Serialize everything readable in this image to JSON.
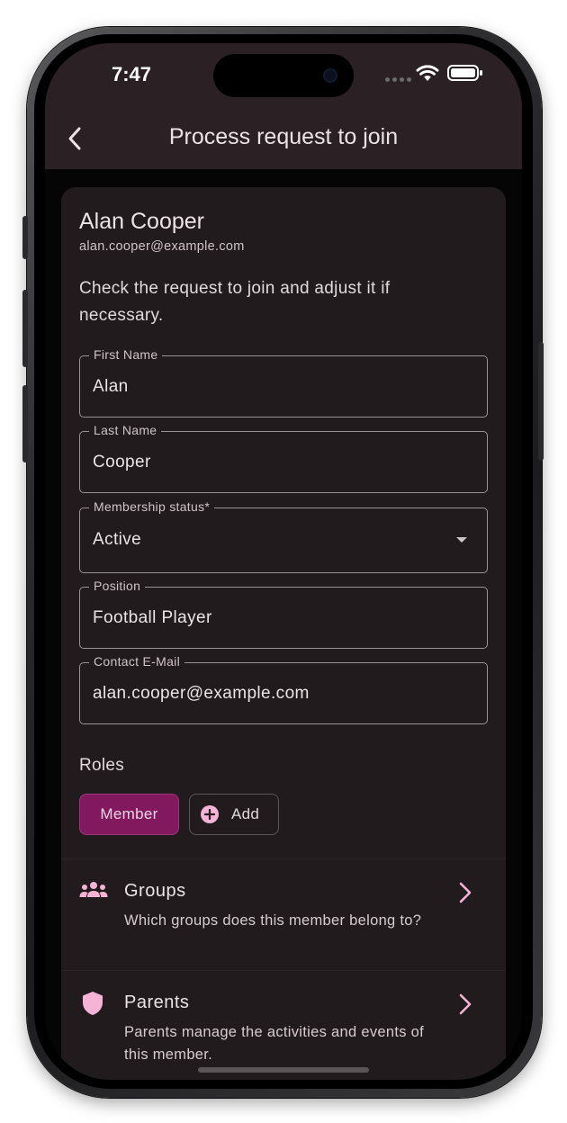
{
  "status_bar": {
    "time": "7:47"
  },
  "app_bar": {
    "title": "Process request to join",
    "back_icon": "chevron-left-icon"
  },
  "member": {
    "name": "Alan Cooper",
    "email": "alan.cooper@example.com"
  },
  "intro": "Check the request to join and adjust it if necessary.",
  "fields": {
    "first_name": {
      "label": "First Name",
      "value": "Alan"
    },
    "last_name": {
      "label": "Last Name",
      "value": "Cooper"
    },
    "membership_status": {
      "label": "Membership status*",
      "value": "Active"
    },
    "position": {
      "label": "Position",
      "value": "Football Player"
    },
    "contact_email": {
      "label": "Contact E-Mail",
      "value": "alan.cooper@example.com"
    }
  },
  "roles": {
    "title": "Roles",
    "chips": [
      "Member"
    ],
    "add_label": "Add"
  },
  "tiles": {
    "groups": {
      "title": "Groups",
      "subtitle": "Which groups does this member belong to?",
      "icon": "groups-icon"
    },
    "parents": {
      "title": "Parents",
      "subtitle": "Parents manage the activities and events of this member.",
      "icon": "shield-icon"
    }
  },
  "colors": {
    "app_bar_bg": "#2b2023",
    "card_bg": "#211b1d",
    "accent_chip": "#82185e",
    "icon_pink": "#f5b3d5"
  }
}
